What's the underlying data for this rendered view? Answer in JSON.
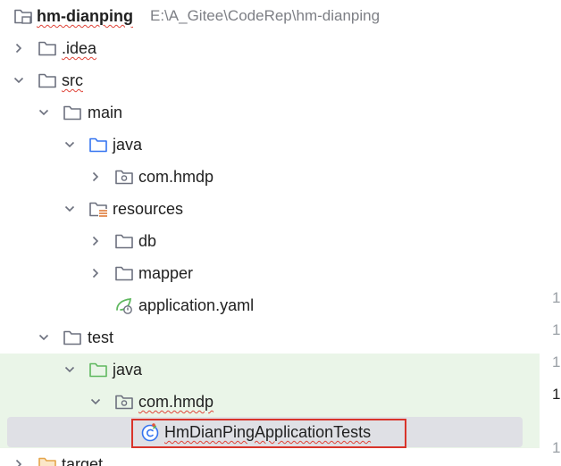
{
  "tree": {
    "root": {
      "name": "hm-dianping",
      "path": "E:\\A_Gitee\\CodeRep\\hm-dianping"
    },
    "idea": ".idea",
    "src": "src",
    "main": "main",
    "main_java": "java",
    "main_pkg": "com.hmdp",
    "resources": "resources",
    "db": "db",
    "mapper": "mapper",
    "app_yaml": "application.yaml",
    "test": "test",
    "test_java": "java",
    "test_pkg": "com.hmdp",
    "test_class": "HmDianPingApplicationTests",
    "target": "target"
  },
  "gutter": {
    "line_numbers": [
      "1",
      "1",
      "1",
      "1",
      "1"
    ]
  },
  "colors": {
    "folder_gray": "#6c707e",
    "folder_blue": "#3574f0",
    "folder_green": "#5fb85f",
    "folder_orange": "#e5a54b",
    "highlight_red": "#d9342b",
    "test_row_bg": "#eaf5e8"
  }
}
